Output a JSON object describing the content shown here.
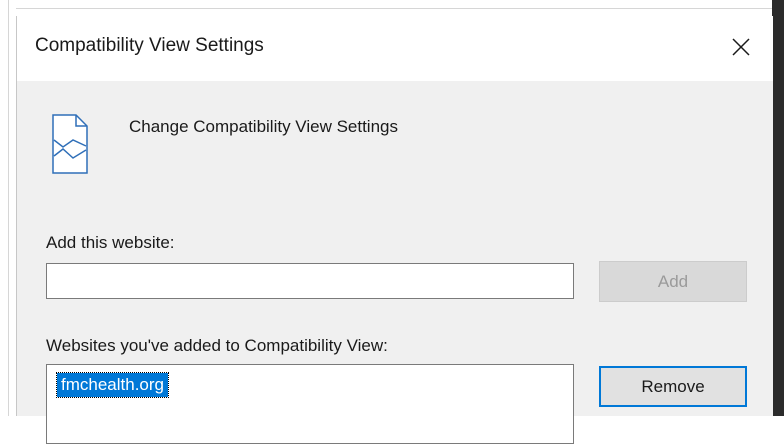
{
  "dialog": {
    "title": "Compatibility View Settings",
    "header_text": "Change Compatibility View Settings",
    "add_label": "Add this website:",
    "add_input_value": "",
    "add_button_label": "Add",
    "list_label": "Websites you've added to Compatibility View:",
    "sites": [
      "fmchealth.org"
    ],
    "remove_button_label": "Remove"
  },
  "icons": {
    "close": "close-icon",
    "header": "compatibility-view-icon"
  },
  "colors": {
    "selection": "#0078d7",
    "focus_border": "#0078d7",
    "dialog_bg": "#f0f0f0"
  }
}
